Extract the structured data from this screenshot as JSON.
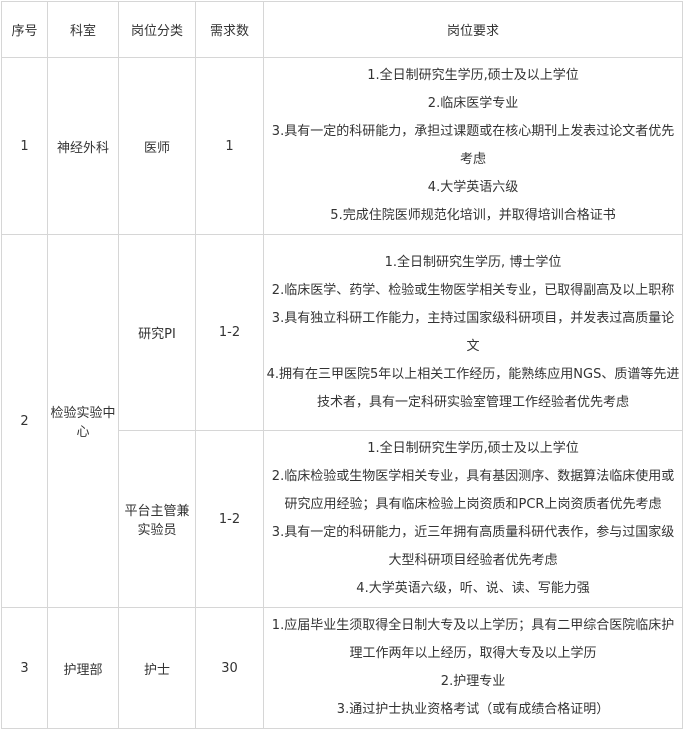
{
  "headers": [
    "序号",
    "科室",
    "岗位分类",
    "需求数",
    "岗位要求"
  ],
  "rows": [
    {
      "no": "1",
      "dept": "神经外科",
      "positions": [
        {
          "category": "医师",
          "count": "1",
          "requirements": [
            "1.全日制研究生学历,硕士及以上学位",
            "2.临床医学专业",
            "3.具有一定的科研能力，承担过课题或在核心期刊上发表过论文者优先考虑",
            "4.大学英语六级",
            "5.完成住院医师规范化培训，并取得培训合格证书"
          ]
        }
      ]
    },
    {
      "no": "2",
      "dept": "检验实验中心",
      "positions": [
        {
          "category": "研究PI",
          "count": "1-2",
          "requirements": [
            "1.全日制研究生学历, 博士学位",
            "2.临床医学、药学、检验或生物医学相关专业，已取得副高及以上职称",
            "3.具有独立科研工作能力，主持过国家级科研项目，并发表过高质量论文",
            "4.拥有在三甲医院5年以上相关工作经历，能熟练应用NGS、质谱等先进技术者，具有一定科研实验室管理工作经验者优先考虑"
          ]
        },
        {
          "category": "平台主管兼实验员",
          "count": "1-2",
          "requirements": [
            "1.全日制研究生学历,硕士及以上学位",
            "2.临床检验或生物医学相关专业，具有基因测序、数据算法临床使用或研究应用经验；具有临床检验上岗资质和PCR上岗资质者优先考虑",
            "3.具有一定的科研能力，近三年拥有高质量科研代表作，参与过国家级大型科研项目经验者优先考虑",
            "4.大学英语六级，听、说、读、写能力强"
          ]
        }
      ]
    },
    {
      "no": "3",
      "dept": "护理部",
      "positions": [
        {
          "category": "护士",
          "count": "30",
          "requirements": [
            "1.应届毕业生须取得全日制大专及以上学历；具有二甲综合医院临床护理工作两年以上经历，取得大专及以上学历",
            "2.护理专业",
            "3.通过护士执业资格考试（或有成绩合格证明）"
          ]
        }
      ]
    }
  ]
}
